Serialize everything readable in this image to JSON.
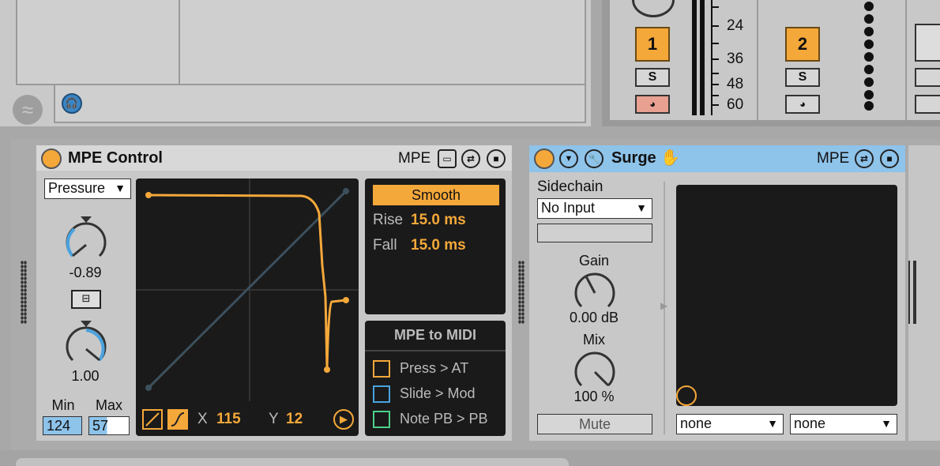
{
  "mixer": {
    "scale_labels": [
      "24",
      "36",
      "48",
      "60"
    ],
    "tracks": [
      {
        "number": "1",
        "solo": "S",
        "arm_color": "#e8a090"
      },
      {
        "number": "2",
        "solo": "S",
        "arm_color": "#d6d6d6"
      }
    ]
  },
  "mpe_control": {
    "title": "MPE Control",
    "mpe_label": "MPE",
    "source_select": "Pressure",
    "knob1_value": "-0.89",
    "knob2_value": "1.00",
    "min_label": "Min",
    "max_label": "Max",
    "min_value": "124",
    "max_value": "57",
    "x_label": "X",
    "x_value": "115",
    "y_label": "Y",
    "y_value": "12",
    "smooth_label": "Smooth",
    "rise_label": "Rise",
    "rise_value": "15.0 ms",
    "fall_label": "Fall",
    "fall_value": "15.0 ms",
    "mpe_to_midi_title": "MPE to MIDI",
    "routes": [
      {
        "label": "Press > AT",
        "color": "#f5a83a"
      },
      {
        "label": "Slide > Mod",
        "color": "#4aa3df"
      },
      {
        "label": "Note PB > PB",
        "color": "#4dd08a"
      }
    ]
  },
  "surge": {
    "title": "Surge",
    "mpe_label": "MPE",
    "sidechain_label": "Sidechain",
    "sidechain_input": "No Input",
    "gain_label": "Gain",
    "gain_value": "0.00 dB",
    "mix_label": "Mix",
    "mix_value": "100 %",
    "mute_label": "Mute",
    "select_left": "none",
    "select_right": "none"
  },
  "colors": {
    "accent": "#f5a83a",
    "surge_header": "#8ec3ea",
    "knob_arc": "#4aa3df"
  }
}
